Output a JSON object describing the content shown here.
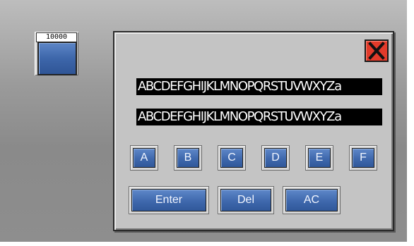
{
  "indicator": {
    "counter": "10000"
  },
  "dialog": {
    "close_icon": "close-x-icon",
    "text_line_1": "ABCDEFGHIJKLMNOPQRSTUVWXYZa",
    "text_line_2": "ABCDEFGHIJKLMNOPQRSTUVWXYZa",
    "letter_keys": [
      "A",
      "B",
      "C",
      "D",
      "E",
      "F"
    ],
    "action_keys": {
      "enter": "Enter",
      "del": "Del",
      "ac": "AC"
    }
  },
  "colors": {
    "key_blue": "#3f68ad",
    "close_red": "#e23a2a",
    "panel_gray": "#c4c4c4"
  }
}
